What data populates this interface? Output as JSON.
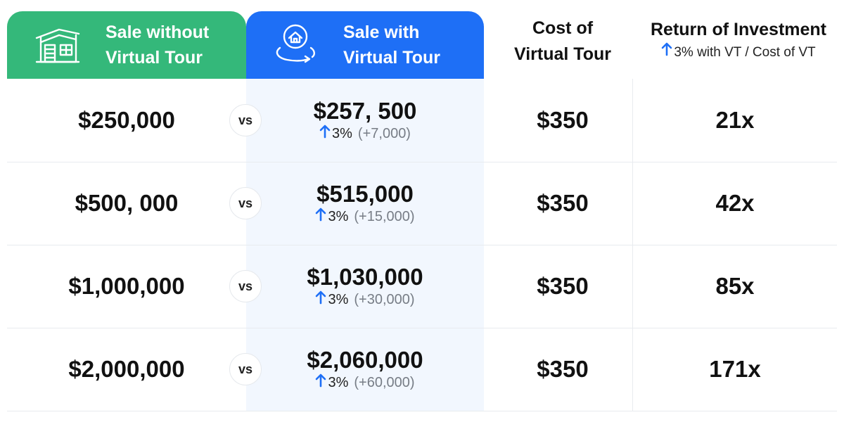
{
  "header": {
    "without_tour": {
      "line1": "Sale without",
      "line2": "Virtual Tour",
      "icon": "house-icon"
    },
    "with_tour": {
      "line1": "Sale with",
      "line2": "Virtual Tour",
      "icon": "360-tour-icon"
    },
    "cost": {
      "line1": "Cost of",
      "line2": "Virtual Tour"
    },
    "roi": {
      "title": "Return of Investment",
      "subtitle": "3% with VT / Cost of VT"
    }
  },
  "vs_label": "vs",
  "rows": [
    {
      "without": "$250,000",
      "with": "$257, 500",
      "pct": "3%",
      "diff": "(+7,000)",
      "cost": "$350",
      "roi": "21x"
    },
    {
      "without": "$500, 000",
      "with": "$515,000",
      "pct": "3%",
      "diff": "(+15,000)",
      "cost": "$350",
      "roi": "42x"
    },
    {
      "without": "$1,000,000",
      "with": "$1,030,000",
      "pct": "3%",
      "diff": "(+30,000)",
      "cost": "$350",
      "roi": "85x"
    },
    {
      "without": "$2,000,000",
      "with": "$2,060,000",
      "pct": "3%",
      "diff": "(+60,000)",
      "cost": "$350",
      "roi": "171x"
    }
  ],
  "colors": {
    "green": "#34b87a",
    "blue": "#1e6ff6",
    "blue_tint": "#f2f7fe",
    "arrow": "#1e6ff6",
    "muted": "#777d86"
  }
}
